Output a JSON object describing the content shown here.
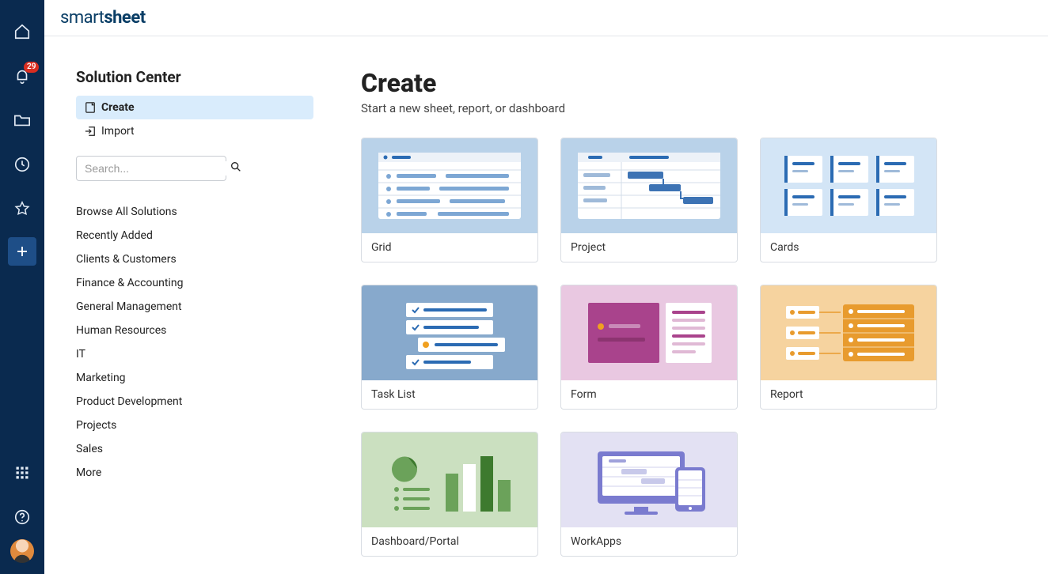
{
  "logo_plain": "smart",
  "logo_bold": "sheet",
  "rail": {
    "notifications_count": "29"
  },
  "panel": {
    "title": "Solution Center",
    "nav": {
      "create": "Create",
      "import": "Import"
    },
    "search_placeholder": "Search...",
    "categories": [
      "Browse All Solutions",
      "Recently Added",
      "Clients & Customers",
      "Finance & Accounting",
      "General Management",
      "Human Resources",
      "IT",
      "Marketing",
      "Product Development",
      "Projects",
      "Sales",
      "More"
    ]
  },
  "content": {
    "heading": "Create",
    "subtitle": "Start a new sheet, report, or dashboard",
    "cards": [
      "Grid",
      "Project",
      "Cards",
      "Task List",
      "Form",
      "Report",
      "Dashboard/Portal",
      "WorkApps"
    ]
  }
}
